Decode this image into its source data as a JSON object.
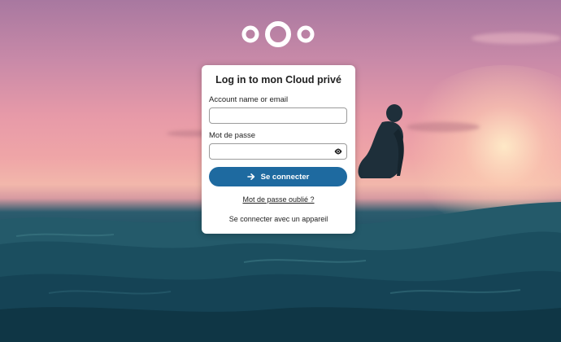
{
  "login": {
    "title": "Log in to mon Cloud privé",
    "account_label": "Account name or email",
    "account_value": "",
    "password_label": "Mot de passe",
    "password_value": "",
    "submit_label": "Se connecter",
    "forgot_label": "Mot de passe oublié ?",
    "device_label": "Se connecter avec un appareil"
  },
  "icons": {
    "logo": "nextcloud-logo",
    "submit": "arrow-right-icon",
    "password_toggle": "eye-icon"
  },
  "colors": {
    "accent": "#1e6aa0",
    "card_background": "#ffffff",
    "text": "#222222"
  }
}
